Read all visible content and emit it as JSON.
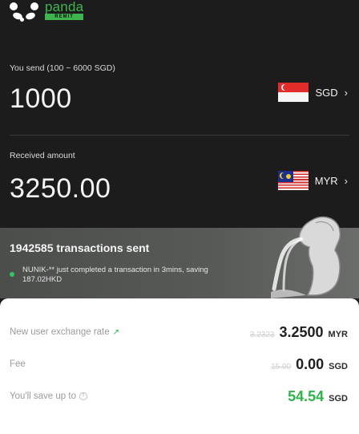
{
  "brand": {
    "name": "panda",
    "tag": "REMIT"
  },
  "send": {
    "label": "You send (100 ~ 6000 SGD)",
    "amount": "1000",
    "currency": "SGD",
    "chevron": "›",
    "flag_icon": "singapore-flag-icon"
  },
  "receive": {
    "label": "Received amount",
    "amount": "3250.00",
    "currency": "MYR",
    "chevron": "›",
    "flag_icon": "malaysia-flag-icon"
  },
  "stats": {
    "transactions_label": "1942585 transactions sent",
    "activity_text": "NUNIK-** just completed a transaction in 3mins, saving 187.02HKD"
  },
  "quote": {
    "rate_label": "New user exchange rate",
    "rate_old": "3.2323",
    "rate_value": "3.2500",
    "rate_unit": "MYR",
    "fee_label": "Fee",
    "fee_old": "15.00",
    "fee_value": "0.00",
    "fee_unit": "SGD",
    "save_label": "You'll save up to",
    "save_value": "54.54",
    "save_unit": "SGD"
  },
  "colors": {
    "accent_green": "#3fb54f",
    "save_green": "#2fb34b",
    "dark_bg": "#1c1c1c"
  }
}
